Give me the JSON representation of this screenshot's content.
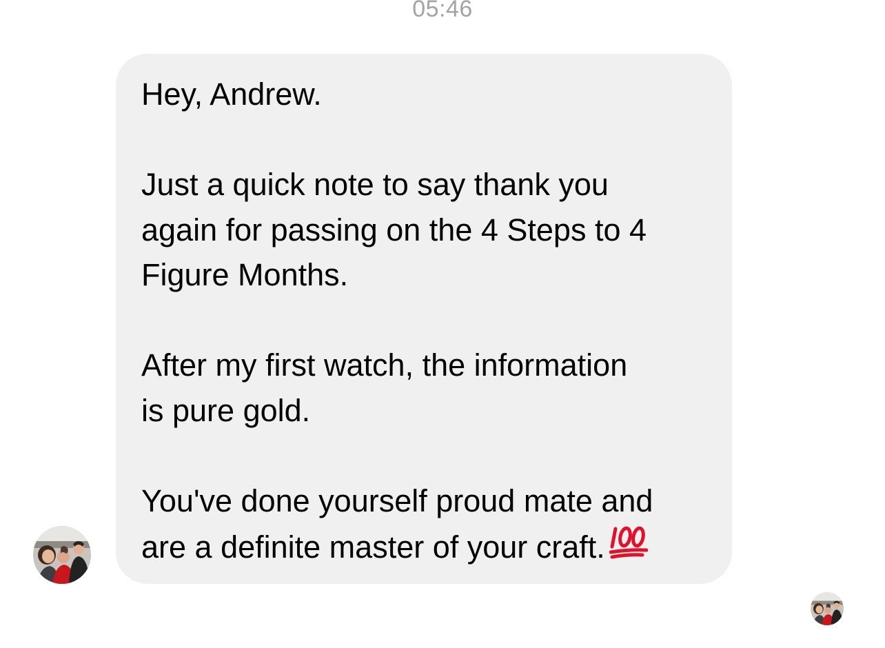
{
  "thread": {
    "timestamp": "05:46"
  },
  "message": {
    "paragraphs": [
      "Hey, Andrew.",
      "Just a quick note to say thank you\nagain for passing on the 4 Steps to 4\nFigure Months.",
      "After my first watch, the information\nis pure gold."
    ],
    "last_paragraph": "You've done yourself proud mate and\nare a definite master of your craft.",
    "emoji": "hundred-points-icon",
    "bubble_color": "#f0f0f0"
  },
  "sender": {
    "avatar": "group-photo-avatar"
  },
  "read_receipt": {
    "avatar": "group-photo-avatar"
  },
  "colors": {
    "timestamp": "#a3a3a3",
    "emoji_red": "#e0112b"
  }
}
